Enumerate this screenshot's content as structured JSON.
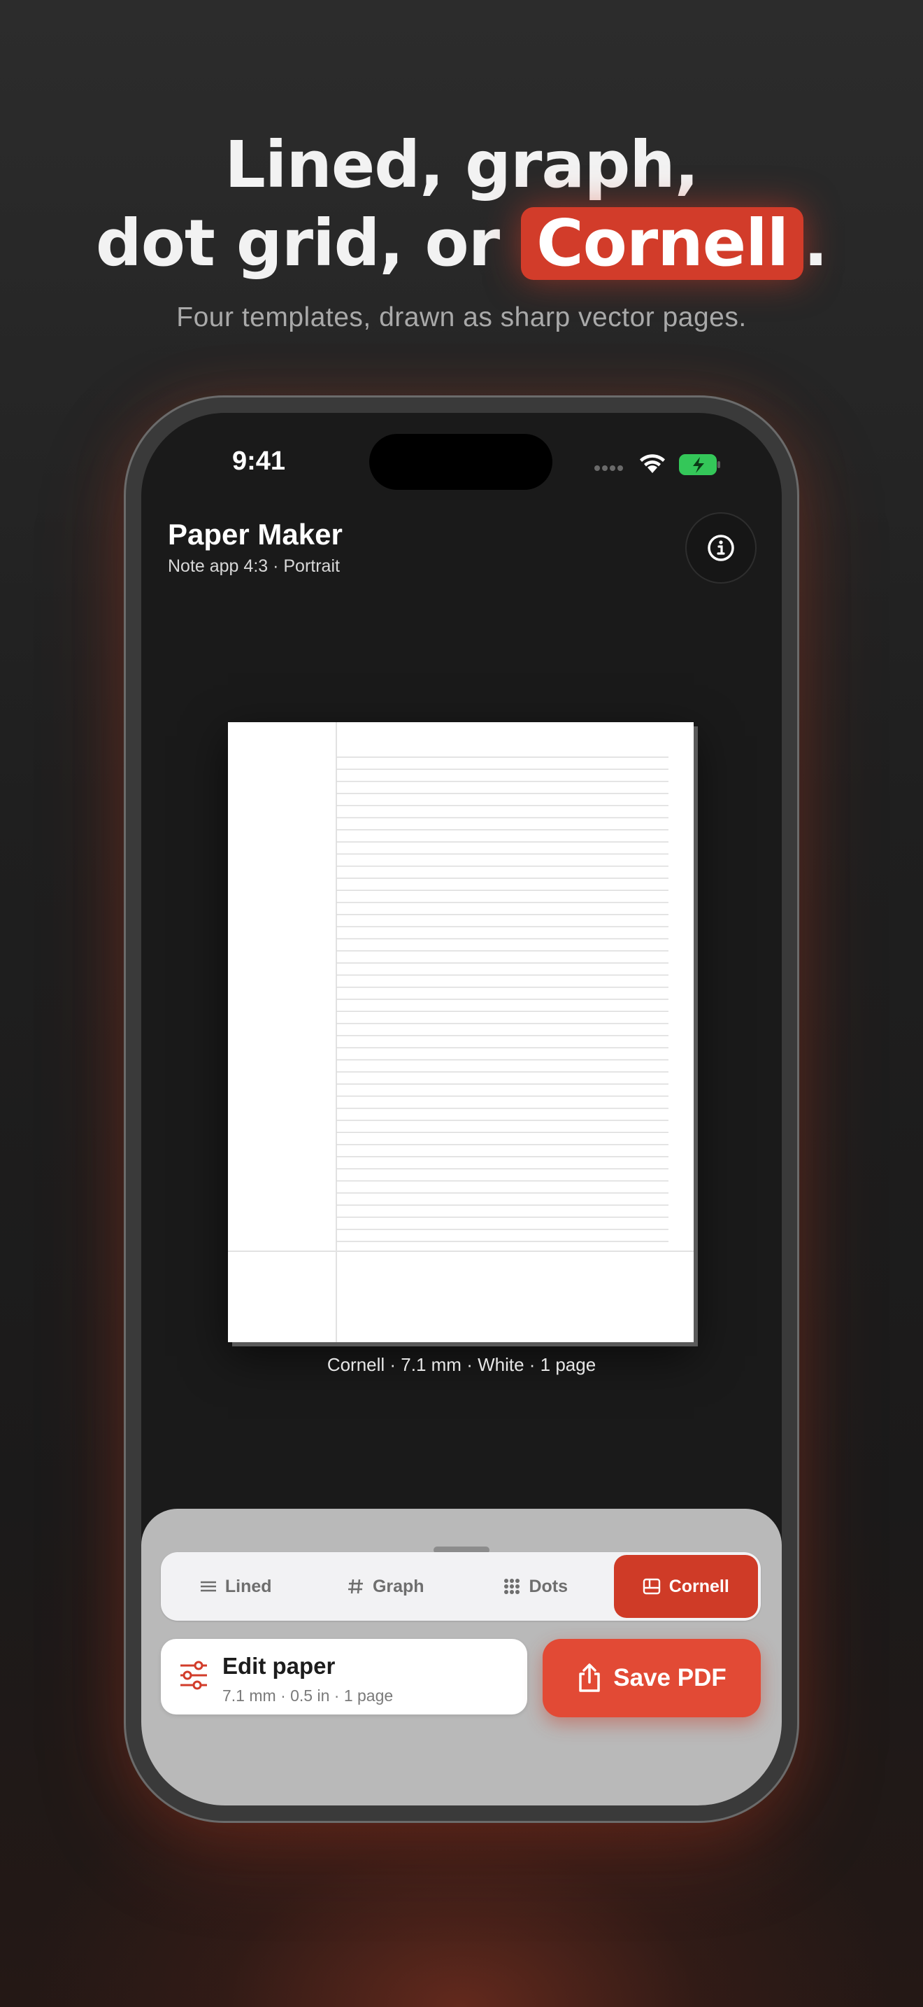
{
  "headline": {
    "line1": "Lined, graph,",
    "line2_prefix": "dot grid, or ",
    "highlight": "Cornell",
    "line2_suffix": "."
  },
  "subheadline": "Four templates, drawn as sharp vector pages.",
  "status_bar": {
    "time": "9:41"
  },
  "app": {
    "title": "Paper Maker",
    "subtitle": "Note app 4:3 · Portrait"
  },
  "preview": {
    "caption": "Cornell · 7.1 mm · White · 1 page",
    "template": "Cornell"
  },
  "template_picker": {
    "items": [
      {
        "label": "Lined",
        "icon": "lines-icon",
        "selected": false
      },
      {
        "label": "Graph",
        "icon": "hash-icon",
        "selected": false
      },
      {
        "label": "Dots",
        "icon": "dots-grid-icon",
        "selected": false
      },
      {
        "label": "Cornell",
        "icon": "cornell-layout-icon",
        "selected": true
      }
    ]
  },
  "edit_paper": {
    "title": "Edit paper",
    "subtitle": "7.1 mm · 0.5 in · 1 page",
    "icon": "sliders-icon"
  },
  "save_button": {
    "label": "Save PDF",
    "icon": "share-icon"
  },
  "colors": {
    "accent": "#d23c2a",
    "save_button": "#e24a35",
    "battery": "#34c759"
  }
}
